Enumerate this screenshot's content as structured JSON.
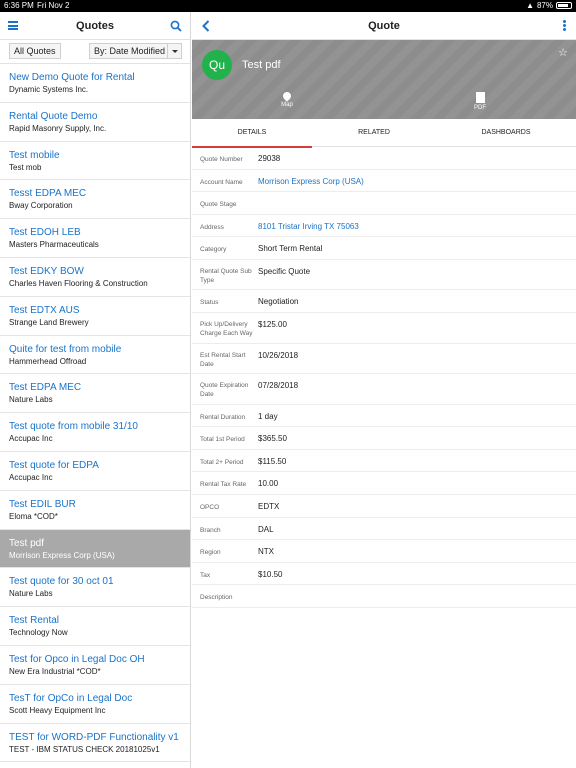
{
  "status_bar": {
    "time": "6:36 PM",
    "date": "Fri Nov 2",
    "battery": "87%",
    "battery_level": 0.87
  },
  "left_panel": {
    "title": "Quotes",
    "filter_label": "All Quotes",
    "sort_label": "By: Date Modified",
    "items": [
      {
        "title": "New Demo Quote for Rental",
        "subtitle": "Dynamic Systems Inc."
      },
      {
        "title": "Rental Quote Demo",
        "subtitle": "Rapid Masonry Supply, Inc."
      },
      {
        "title": "Test mobile",
        "subtitle": "Test mob"
      },
      {
        "title": "Tesst EDPA MEC",
        "subtitle": "Bway Corporation"
      },
      {
        "title": "Test EDOH LEB",
        "subtitle": "Masters Pharmaceuticals"
      },
      {
        "title": "Test EDKY BOW",
        "subtitle": "Charles Haven Flooring & Construction"
      },
      {
        "title": "Test EDTX AUS",
        "subtitle": "Strange Land Brewery"
      },
      {
        "title": "Quite for test from mobile",
        "subtitle": "Hammerhead Offroad"
      },
      {
        "title": "Test EDPA MEC",
        "subtitle": "Nature Labs"
      },
      {
        "title": "Test quote from mobile 31/10",
        "subtitle": "Accupac Inc"
      },
      {
        "title": "Test quote for EDPA",
        "subtitle": "Accupac Inc"
      },
      {
        "title": "Test EDIL BUR",
        "subtitle": "Eloma *COD*"
      },
      {
        "title": "Test pdf",
        "subtitle": "Morrison Express Corp (USA)"
      },
      {
        "title": "Test quote for 30 oct 01",
        "subtitle": "Nature Labs"
      },
      {
        "title": "Test Rental",
        "subtitle": "Technology Now"
      },
      {
        "title": "Test for Opco in Legal Doc OH",
        "subtitle": "New Era Industrial *COD*"
      },
      {
        "title": "TesT for OpCo in Legal Doc",
        "subtitle": "Scott Heavy Equipment Inc"
      },
      {
        "title": "TEST for WORD-PDF Functionality v1",
        "subtitle": "TEST - IBM STATUS CHECK 20181025v1"
      }
    ]
  },
  "right_panel": {
    "title": "Quote",
    "avatar_initials": "Qu",
    "record_name": "Test pdf",
    "actions": {
      "map": "Map",
      "pdf": "PDF"
    },
    "tabs": {
      "details": "DETAILS",
      "related": "RELATED",
      "dashboards": "DASHBOARDS"
    },
    "fields": {
      "quote_number": {
        "label": "Quote Number",
        "value": "29038"
      },
      "account_name": {
        "label": "Account Name",
        "value": "Morrison Express Corp (USA)"
      },
      "quote_stage": {
        "label": "Quote Stage",
        "value": ""
      },
      "address": {
        "label": "Address",
        "value": "8101 Tristar Irving TX 75063"
      },
      "category": {
        "label": "Category",
        "value": "Short Term Rental"
      },
      "sub_type": {
        "label": "Rental Quote Sub Type",
        "value": "Specific Quote"
      },
      "status": {
        "label": "Status",
        "value": "Negotiation"
      },
      "pickup_charge": {
        "label": "Pick Up/Delivery Charge Each Way",
        "value": "$125.00"
      },
      "est_start": {
        "label": "Est Rental Start Date",
        "value": "10/26/2018"
      },
      "expiration": {
        "label": "Quote Expiration Date",
        "value": "07/28/2018"
      },
      "duration": {
        "label": "Rental Duration",
        "value": "1 day"
      },
      "total_1st": {
        "label": "Total 1st Period",
        "value": "$365.50"
      },
      "total_2plus": {
        "label": "Total 2+ Period",
        "value": "$115.50"
      },
      "tax_rate": {
        "label": "Rental Tax Rate",
        "value": "10.00"
      },
      "opco": {
        "label": "OPCO",
        "value": "EDTX"
      },
      "branch": {
        "label": "Branch",
        "value": "DAL"
      },
      "region": {
        "label": "Region",
        "value": "NTX"
      },
      "tax": {
        "label": "Tax",
        "value": "$10.50"
      },
      "description": {
        "label": "Description",
        "value": ""
      }
    }
  },
  "colors": {
    "accent": "#1a73c8",
    "avatar": "#22b24c",
    "tab_indicator": "#d93b3b",
    "selected_row": "#a9a9a9",
    "hero_bg": "#8d8d8d"
  }
}
